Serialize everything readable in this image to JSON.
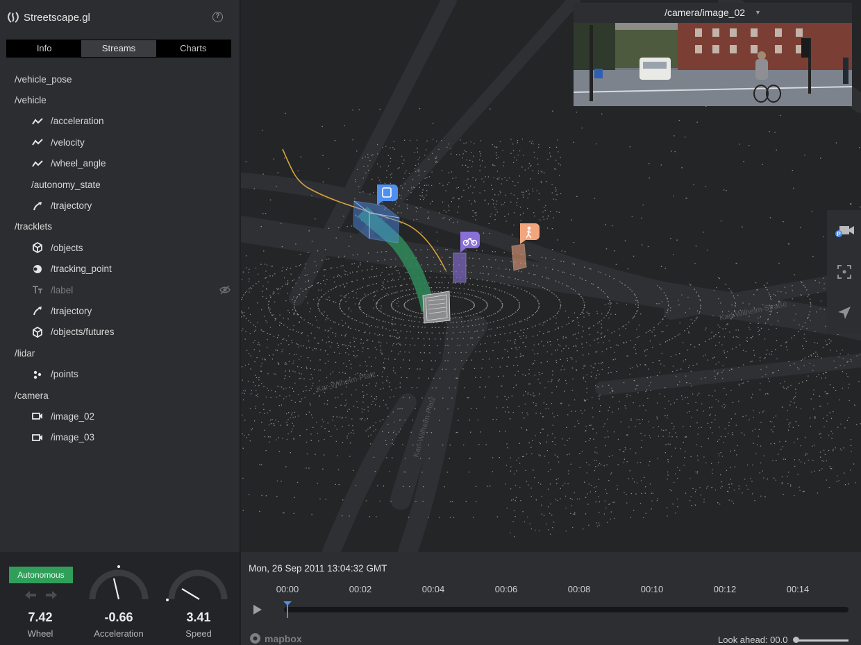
{
  "app": {
    "title": "Streetscape.gl",
    "help_icon": "help-circle-icon"
  },
  "tabs": [
    {
      "label": "Info",
      "active": false
    },
    {
      "label": "Streams",
      "active": true
    },
    {
      "label": "Charts",
      "active": false
    }
  ],
  "streams": [
    {
      "label": "/vehicle_pose",
      "level": 0,
      "icon": null
    },
    {
      "label": "/vehicle",
      "level": 0,
      "icon": null
    },
    {
      "label": "/acceleration",
      "level": 1,
      "icon": "line-chart-icon"
    },
    {
      "label": "/velocity",
      "level": 1,
      "icon": "line-chart-icon"
    },
    {
      "label": "/wheel_angle",
      "level": 1,
      "icon": "line-chart-icon"
    },
    {
      "label": "/autonomy_state",
      "level": 1,
      "icon": null
    },
    {
      "label": "/trajectory",
      "level": 1,
      "icon": "trajectory-icon"
    },
    {
      "label": "/tracklets",
      "level": 0,
      "icon": null
    },
    {
      "label": "/objects",
      "level": 1,
      "icon": "cube-icon"
    },
    {
      "label": "/tracking_point",
      "level": 1,
      "icon": "circle-point-icon"
    },
    {
      "label": "/label",
      "level": 1,
      "icon": "text-icon",
      "hidden": true
    },
    {
      "label": "/trajectory",
      "level": 1,
      "icon": "trajectory-icon"
    },
    {
      "label": "/objects/futures",
      "level": 1,
      "icon": "cube-icon"
    },
    {
      "label": "/lidar",
      "level": 0,
      "icon": null
    },
    {
      "label": "/points",
      "level": 1,
      "icon": "points-icon"
    },
    {
      "label": "/camera",
      "level": 0,
      "icon": null
    },
    {
      "label": "/image_02",
      "level": 1,
      "icon": "video-icon"
    },
    {
      "label": "/image_03",
      "level": 1,
      "icon": "video-icon"
    }
  ],
  "metrics": {
    "autonomy_badge": "Autonomous",
    "wheel": {
      "value": "7.42",
      "label": "Wheel"
    },
    "acceleration": {
      "value": "-0.66",
      "label": "Acceleration"
    },
    "speed": {
      "value": "3.41",
      "label": "Speed"
    }
  },
  "map": {
    "street_labels": [
      "Karl-Wilhelm-Platz",
      "Karl-Wilhelm-Straße",
      "Kar-Wilhelm-Platz"
    ],
    "object_markers": [
      {
        "type": "bus",
        "icon": "bus-icon",
        "color": "#4f8ff0"
      },
      {
        "type": "bicycle",
        "icon": "bicycle-icon",
        "color": "#8a6fd8"
      },
      {
        "type": "pedestrian",
        "icon": "pedestrian-icon",
        "color": "#f3a57e"
      }
    ]
  },
  "camera": {
    "title": "/camera/image_02"
  },
  "tools": [
    "camera-view-icon",
    "focus-frame-icon",
    "navigate-arrow-icon"
  ],
  "timeline": {
    "timestamp": "Mon, 26 Sep 2011 13:04:32 GMT",
    "ticks": [
      "00:00",
      "00:02",
      "00:04",
      "00:06",
      "00:08",
      "00:10",
      "00:12",
      "00:14"
    ],
    "progress": 0,
    "look_ahead": "Look ahead: 00.0",
    "attribution": "mapbox"
  }
}
